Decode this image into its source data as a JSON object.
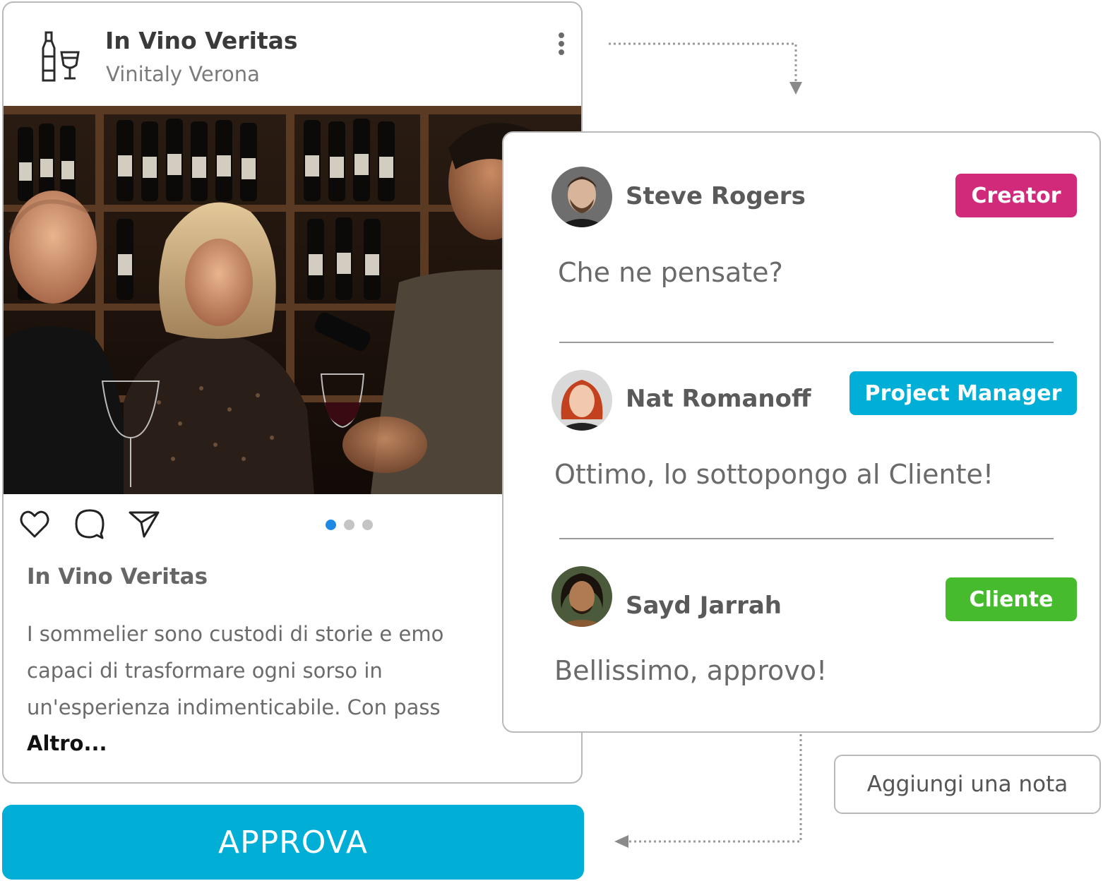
{
  "post": {
    "title": "In Vino Veritas",
    "subtitle": "Vinitaly Verona",
    "caption_title": "In Vino Veritas",
    "caption_lines": [
      "I sommelier sono custodi di storie e emo",
      "capaci di trasformare ogni sorso in",
      "un'esperienza indimenticabile. Con pass"
    ],
    "read_more": "Altro...",
    "carousel": {
      "total": 3,
      "active": 1
    },
    "icons": [
      "wine-logo-icon",
      "more-vertical-icon",
      "heart-icon",
      "comment-icon",
      "share-icon"
    ]
  },
  "approve_button": {
    "label": "APPROVA",
    "color": "#00aed6"
  },
  "comments": [
    {
      "author": "Steve Rogers",
      "role": "Creator",
      "role_color": "#d12a7a",
      "text": "Che ne pensate?"
    },
    {
      "author": "Nat Romanoff",
      "role": "Project Manager",
      "role_color": "#00aed6",
      "text": "Ottimo, lo sottopongo al Cliente!"
    },
    {
      "author": "Sayd Jarrah",
      "role": "Cliente",
      "role_color": "#47bb2e",
      "text": "Bellissimo, approvo!"
    }
  ],
  "add_note_button": {
    "label": "Aggiungi una nota"
  }
}
